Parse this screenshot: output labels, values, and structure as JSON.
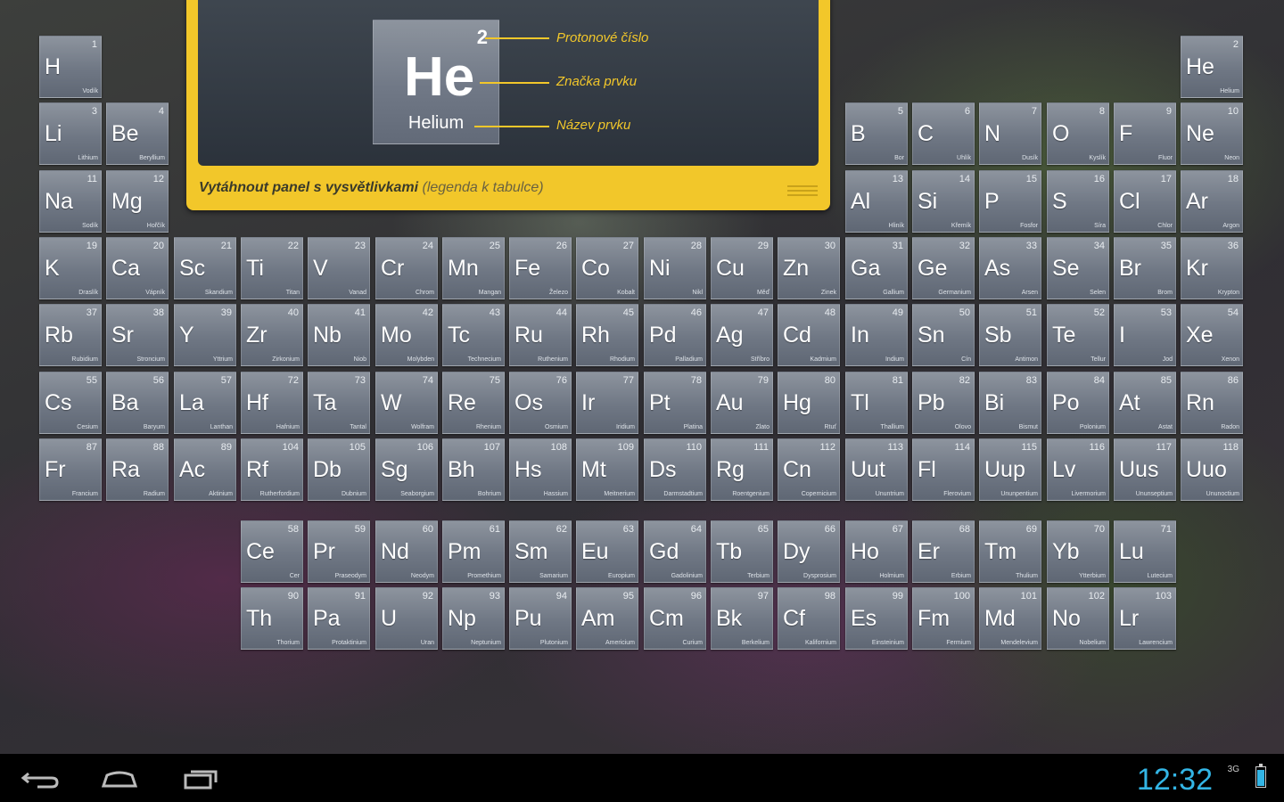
{
  "legend": {
    "sample": {
      "number": "2",
      "symbol": "He",
      "name": "Helium"
    },
    "callouts": [
      "Protonové číslo",
      "Značka prvku",
      "Název prvku"
    ],
    "footer_bold": "Vytáhnout panel s vysvětlivkami",
    "footer_light": "(legenda k tabulce)"
  },
  "main_table": [
    [
      {
        "n": "1",
        "s": "H",
        "name": "Vodík"
      },
      null,
      null,
      null,
      null,
      null,
      null,
      null,
      null,
      null,
      null,
      null,
      null,
      null,
      null,
      null,
      null,
      {
        "n": "2",
        "s": "He",
        "name": "Helium"
      }
    ],
    [
      {
        "n": "3",
        "s": "Li",
        "name": "Lithium"
      },
      {
        "n": "4",
        "s": "Be",
        "name": "Beryllium"
      },
      null,
      null,
      null,
      null,
      null,
      null,
      null,
      null,
      null,
      null,
      {
        "n": "5",
        "s": "B",
        "name": "Bor"
      },
      {
        "n": "6",
        "s": "C",
        "name": "Uhlík"
      },
      {
        "n": "7",
        "s": "N",
        "name": "Dusík"
      },
      {
        "n": "8",
        "s": "O",
        "name": "Kyslík"
      },
      {
        "n": "9",
        "s": "F",
        "name": "Fluor"
      },
      {
        "n": "10",
        "s": "Ne",
        "name": "Neon"
      }
    ],
    [
      {
        "n": "11",
        "s": "Na",
        "name": "Sodík"
      },
      {
        "n": "12",
        "s": "Mg",
        "name": "Hořčík"
      },
      null,
      null,
      null,
      null,
      null,
      null,
      null,
      null,
      null,
      null,
      {
        "n": "13",
        "s": "Al",
        "name": "Hliník"
      },
      {
        "n": "14",
        "s": "Si",
        "name": "Křemík"
      },
      {
        "n": "15",
        "s": "P",
        "name": "Fosfor"
      },
      {
        "n": "16",
        "s": "S",
        "name": "Síra"
      },
      {
        "n": "17",
        "s": "Cl",
        "name": "Chlor"
      },
      {
        "n": "18",
        "s": "Ar",
        "name": "Argon"
      }
    ],
    [
      {
        "n": "19",
        "s": "K",
        "name": "Draslík"
      },
      {
        "n": "20",
        "s": "Ca",
        "name": "Vápník"
      },
      {
        "n": "21",
        "s": "Sc",
        "name": "Skandium"
      },
      {
        "n": "22",
        "s": "Ti",
        "name": "Titan"
      },
      {
        "n": "23",
        "s": "V",
        "name": "Vanad"
      },
      {
        "n": "24",
        "s": "Cr",
        "name": "Chrom"
      },
      {
        "n": "25",
        "s": "Mn",
        "name": "Mangan"
      },
      {
        "n": "26",
        "s": "Fe",
        "name": "Železo"
      },
      {
        "n": "27",
        "s": "Co",
        "name": "Kobalt"
      },
      {
        "n": "28",
        "s": "Ni",
        "name": "Nikl"
      },
      {
        "n": "29",
        "s": "Cu",
        "name": "Měď"
      },
      {
        "n": "30",
        "s": "Zn",
        "name": "Zinek"
      },
      {
        "n": "31",
        "s": "Ga",
        "name": "Gallium"
      },
      {
        "n": "32",
        "s": "Ge",
        "name": "Germanium"
      },
      {
        "n": "33",
        "s": "As",
        "name": "Arsen"
      },
      {
        "n": "34",
        "s": "Se",
        "name": "Selen"
      },
      {
        "n": "35",
        "s": "Br",
        "name": "Brom"
      },
      {
        "n": "36",
        "s": "Kr",
        "name": "Krypton"
      }
    ],
    [
      {
        "n": "37",
        "s": "Rb",
        "name": "Rubidium"
      },
      {
        "n": "38",
        "s": "Sr",
        "name": "Stroncium"
      },
      {
        "n": "39",
        "s": "Y",
        "name": "Yttrium"
      },
      {
        "n": "40",
        "s": "Zr",
        "name": "Zirkonium"
      },
      {
        "n": "41",
        "s": "Nb",
        "name": "Niob"
      },
      {
        "n": "42",
        "s": "Mo",
        "name": "Molybden"
      },
      {
        "n": "43",
        "s": "Tc",
        "name": "Technecium"
      },
      {
        "n": "44",
        "s": "Ru",
        "name": "Ruthenium"
      },
      {
        "n": "45",
        "s": "Rh",
        "name": "Rhodium"
      },
      {
        "n": "46",
        "s": "Pd",
        "name": "Palladium"
      },
      {
        "n": "47",
        "s": "Ag",
        "name": "Stříbro"
      },
      {
        "n": "48",
        "s": "Cd",
        "name": "Kadmium"
      },
      {
        "n": "49",
        "s": "In",
        "name": "Indium"
      },
      {
        "n": "50",
        "s": "Sn",
        "name": "Cín"
      },
      {
        "n": "51",
        "s": "Sb",
        "name": "Antimon"
      },
      {
        "n": "52",
        "s": "Te",
        "name": "Tellur"
      },
      {
        "n": "53",
        "s": "I",
        "name": "Jod"
      },
      {
        "n": "54",
        "s": "Xe",
        "name": "Xenon"
      }
    ],
    [
      {
        "n": "55",
        "s": "Cs",
        "name": "Cesium"
      },
      {
        "n": "56",
        "s": "Ba",
        "name": "Baryum"
      },
      {
        "n": "57",
        "s": "La",
        "name": "Lanthan"
      },
      {
        "n": "72",
        "s": "Hf",
        "name": "Hafnium"
      },
      {
        "n": "73",
        "s": "Ta",
        "name": "Tantal"
      },
      {
        "n": "74",
        "s": "W",
        "name": "Wolfram"
      },
      {
        "n": "75",
        "s": "Re",
        "name": "Rhenium"
      },
      {
        "n": "76",
        "s": "Os",
        "name": "Osmium"
      },
      {
        "n": "77",
        "s": "Ir",
        "name": "Iridium"
      },
      {
        "n": "78",
        "s": "Pt",
        "name": "Platina"
      },
      {
        "n": "79",
        "s": "Au",
        "name": "Zlato"
      },
      {
        "n": "80",
        "s": "Hg",
        "name": "Rtuť"
      },
      {
        "n": "81",
        "s": "Tl",
        "name": "Thallium"
      },
      {
        "n": "82",
        "s": "Pb",
        "name": "Olovo"
      },
      {
        "n": "83",
        "s": "Bi",
        "name": "Bismut"
      },
      {
        "n": "84",
        "s": "Po",
        "name": "Polonium"
      },
      {
        "n": "85",
        "s": "At",
        "name": "Astat"
      },
      {
        "n": "86",
        "s": "Rn",
        "name": "Radon"
      }
    ],
    [
      {
        "n": "87",
        "s": "Fr",
        "name": "Francium"
      },
      {
        "n": "88",
        "s": "Ra",
        "name": "Radium"
      },
      {
        "n": "89",
        "s": "Ac",
        "name": "Aktinium"
      },
      {
        "n": "104",
        "s": "Rf",
        "name": "Rutherfordium"
      },
      {
        "n": "105",
        "s": "Db",
        "name": "Dubnium"
      },
      {
        "n": "106",
        "s": "Sg",
        "name": "Seaborgium"
      },
      {
        "n": "107",
        "s": "Bh",
        "name": "Bohrium"
      },
      {
        "n": "108",
        "s": "Hs",
        "name": "Hassium"
      },
      {
        "n": "109",
        "s": "Mt",
        "name": "Meitnerium"
      },
      {
        "n": "110",
        "s": "Ds",
        "name": "Darmstadtium"
      },
      {
        "n": "111",
        "s": "Rg",
        "name": "Roentgenium"
      },
      {
        "n": "112",
        "s": "Cn",
        "name": "Copernicium"
      },
      {
        "n": "113",
        "s": "Uut",
        "name": "Ununtrium"
      },
      {
        "n": "114",
        "s": "Fl",
        "name": "Flerovium"
      },
      {
        "n": "115",
        "s": "Uup",
        "name": "Ununpentium"
      },
      {
        "n": "116",
        "s": "Lv",
        "name": "Livermorium"
      },
      {
        "n": "117",
        "s": "Uus",
        "name": "Ununseptium"
      },
      {
        "n": "118",
        "s": "Uuo",
        "name": "Ununoctium"
      }
    ]
  ],
  "lanthanides": [
    {
      "n": "58",
      "s": "Ce",
      "name": "Cer"
    },
    {
      "n": "59",
      "s": "Pr",
      "name": "Praseodym"
    },
    {
      "n": "60",
      "s": "Nd",
      "name": "Neodym"
    },
    {
      "n": "61",
      "s": "Pm",
      "name": "Promethium"
    },
    {
      "n": "62",
      "s": "Sm",
      "name": "Samarium"
    },
    {
      "n": "63",
      "s": "Eu",
      "name": "Europium"
    },
    {
      "n": "64",
      "s": "Gd",
      "name": "Gadolinium"
    },
    {
      "n": "65",
      "s": "Tb",
      "name": "Terbium"
    },
    {
      "n": "66",
      "s": "Dy",
      "name": "Dysprosium"
    },
    {
      "n": "67",
      "s": "Ho",
      "name": "Holmium"
    },
    {
      "n": "68",
      "s": "Er",
      "name": "Erbium"
    },
    {
      "n": "69",
      "s": "Tm",
      "name": "Thulium"
    },
    {
      "n": "70",
      "s": "Yb",
      "name": "Ytterbium"
    },
    {
      "n": "71",
      "s": "Lu",
      "name": "Lutecium"
    }
  ],
  "actinides": [
    {
      "n": "90",
      "s": "Th",
      "name": "Thorium"
    },
    {
      "n": "91",
      "s": "Pa",
      "name": "Protaktinium"
    },
    {
      "n": "92",
      "s": "U",
      "name": "Uran"
    },
    {
      "n": "93",
      "s": "Np",
      "name": "Neptunium"
    },
    {
      "n": "94",
      "s": "Pu",
      "name": "Plutonium"
    },
    {
      "n": "95",
      "s": "Am",
      "name": "Americium"
    },
    {
      "n": "96",
      "s": "Cm",
      "name": "Curium"
    },
    {
      "n": "97",
      "s": "Bk",
      "name": "Berkelium"
    },
    {
      "n": "98",
      "s": "Cf",
      "name": "Kalifornium"
    },
    {
      "n": "99",
      "s": "Es",
      "name": "Einsteinium"
    },
    {
      "n": "100",
      "s": "Fm",
      "name": "Fermium"
    },
    {
      "n": "101",
      "s": "Md",
      "name": "Mendelevium"
    },
    {
      "n": "102",
      "s": "No",
      "name": "Nobelium"
    },
    {
      "n": "103",
      "s": "Lr",
      "name": "Lawrencium"
    }
  ],
  "navbar": {
    "icons": [
      "back-icon",
      "home-icon",
      "recent-apps-icon"
    ],
    "clock": "12:32",
    "signal": "3G",
    "battery_level": 0.8
  },
  "colors": {
    "accent": "#33b5e5",
    "legend_yellow": "#f2c72a"
  }
}
